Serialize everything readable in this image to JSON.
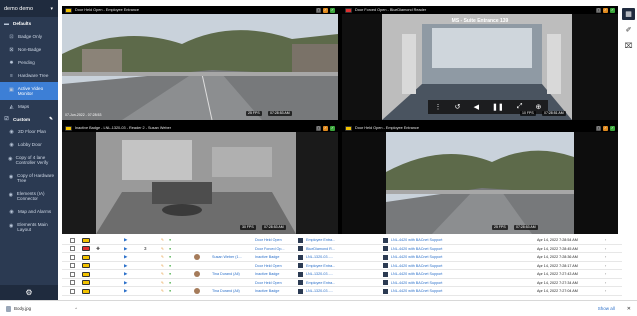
{
  "sidebar": {
    "account": "demo demo",
    "defaults_label": "Defaults",
    "items": [
      {
        "label": "Badge Only",
        "icon": "badge-icon"
      },
      {
        "label": "Non-Badge",
        "icon": "non-badge-icon"
      },
      {
        "label": "Pending",
        "icon": "gear-icon"
      },
      {
        "label": "Hardware Tree",
        "icon": "tree-icon"
      },
      {
        "label": "Active Video Monitor",
        "icon": "video-monitor-icon"
      },
      {
        "label": "Maps",
        "icon": "map-icon"
      }
    ],
    "custom_label": "Custom",
    "custom_items": [
      {
        "label": "2D Floor Plan"
      },
      {
        "label": "Lobby Door"
      },
      {
        "label": "Copy of 4 lane Controller Verify"
      },
      {
        "label": "Copy of Hardware Tree"
      },
      {
        "label": "Elements (IA) Connector"
      },
      {
        "label": "Map and Alarms"
      },
      {
        "label": "Elements Main Layout"
      }
    ]
  },
  "cameras": [
    {
      "title": "Door Held Open - Employee Entrance",
      "fps": "25 FPS",
      "time": "07:28:53 AM",
      "timestamp": "07-Jun-2022 - 07:28:53"
    },
    {
      "title": "Door Forced Open - BlueDiamond Reader",
      "overlay": "MS - Suite Entrance 139",
      "fps": "10 FPS",
      "time": "07:28:51 AM"
    },
    {
      "title": "Inactive Badge - LNL-1320-03 - Reader 2 - Susan Weber",
      "fps": "30 FPS",
      "time": "07:28:53 AM"
    },
    {
      "title": "Door Held Open - Employee Entrance",
      "fps": "25 FPS",
      "time": "07:28:53 AM"
    }
  ],
  "table": {
    "rows": [
      {
        "count": "",
        "person": "",
        "event": "Door Held Open",
        "reader": "Employee Entra...",
        "panel": "LNL-4420 with BACnet Support",
        "date": "Apr 14, 2022 7:28:54 AM",
        "red": false
      },
      {
        "count": "3",
        "person": "",
        "event": "Door Forced Op...",
        "reader": "BlueDiamond R...",
        "panel": "LNL-4420 with BACnet Support",
        "date": "Apr 14, 2022 7:28:45 AM",
        "red": true
      },
      {
        "count": "",
        "person": "Susan Weber (1...",
        "event": "Inactive Badge",
        "reader": "LNL-1320-03 -...",
        "panel": "LNL-4420 with BACnet Support",
        "date": "Apr 14, 2022 7:28:36 AM",
        "red": false
      },
      {
        "count": "",
        "person": "",
        "event": "Door Held Open",
        "reader": "Employee Entra...",
        "panel": "LNL-4420 with BACnet Support",
        "date": "Apr 14, 2022 7:28:17 AM",
        "red": false
      },
      {
        "count": "",
        "person": "Tina Durand (All)",
        "event": "Inactive Badge",
        "reader": "LNL-1320-03 -...",
        "panel": "LNL-4420 with BACnet Support",
        "date": "Apr 14, 2022 7:27:43 AM",
        "red": false
      },
      {
        "count": "",
        "person": "",
        "event": "Door Held Open",
        "reader": "Employee Entra...",
        "panel": "LNL-4420 with BACnet Support",
        "date": "Apr 14, 2022 7:27:34 AM",
        "red": false
      },
      {
        "count": "",
        "person": "Tina Durand (All)",
        "event": "Inactive Badge",
        "reader": "LNL-1320-03 -...",
        "panel": "LNL-4420 with BACnet Support",
        "date": "Apr 14, 2022 7:27:04 AM",
        "red": false
      }
    ]
  },
  "downloads": {
    "file": "Body.jpg",
    "show_all": "Show all"
  },
  "colors": {
    "sidebar": "#2b3a52",
    "active": "#3d7fd6",
    "alarm_yellow": "#f2c200",
    "alarm_red": "#e03030",
    "link": "#2a6fc9"
  }
}
